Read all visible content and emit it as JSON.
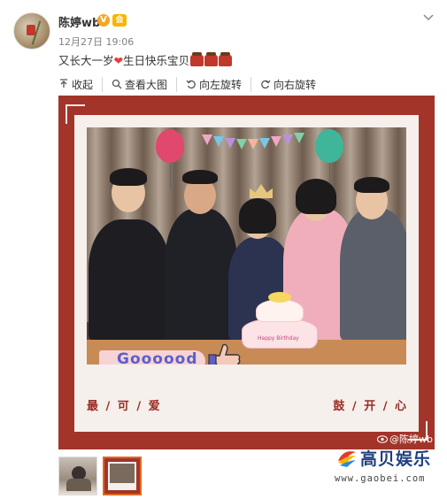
{
  "post": {
    "username": "陈婷wb",
    "verified_badge": "V",
    "vip_badge": "会",
    "timestamp": "12月27日 19:06",
    "text_before_heart": "又长大一岁",
    "text_after_heart": "生日快乐宝贝",
    "heart_icon": "red-heart-icon",
    "trailing_icons": [
      "cake-icon",
      "cake-icon",
      "cake-icon"
    ]
  },
  "toolbar": {
    "collapse_label": "收起",
    "view_large_label": "查看大图",
    "rotate_left_label": "向左旋转",
    "rotate_right_label": "向右旋转"
  },
  "photo": {
    "sticker_text": "Goooood",
    "caption_left": "最 / 可 / 爱",
    "caption_right": "鼓 / 开 / 心",
    "cake_text": "Happy Birthday",
    "watermark": "@陈婷wb"
  },
  "thumbnails": [
    {
      "name": "thumbnail-1",
      "active": false
    },
    {
      "name": "thumbnail-2",
      "active": true
    }
  ],
  "site": {
    "name": "高贝娱乐",
    "url": "www.gaobei.com"
  },
  "colors": {
    "frame_red": "#a2342a",
    "accent_orange": "#e06a1f",
    "sticker_text": "#5b5fc7",
    "heart": "#e83a3a"
  }
}
